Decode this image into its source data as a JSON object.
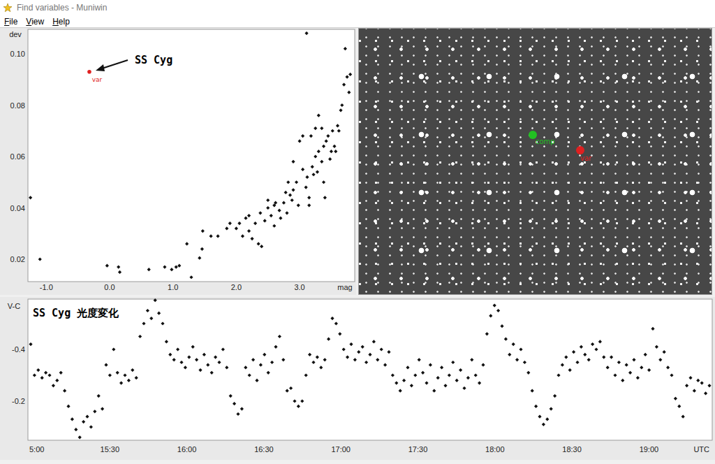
{
  "window": {
    "title": "Find variables - Muniwin"
  },
  "menu": [
    "File",
    "View",
    "Help"
  ],
  "scatter_chart": {
    "y_label": "dev",
    "x_label": "mag",
    "y_ticks": [
      "0.10",
      "0.08",
      "0.06",
      "0.04",
      "0.02"
    ],
    "x_ticks": [
      "-1.0",
      "0.0",
      "1.0",
      "2.0",
      "3.0"
    ],
    "annotation": "SS Cyg",
    "variable": {
      "label": "var",
      "mag": -0.32,
      "dev": 0.093,
      "color": "#e02020"
    },
    "stars": [
      [
        -1.25,
        0.044
      ],
      [
        -1.1,
        0.02
      ],
      [
        -0.04,
        0.0175
      ],
      [
        0.14,
        0.017
      ],
      [
        0.16,
        0.015
      ],
      [
        0.62,
        0.016
      ],
      [
        0.87,
        0.017
      ],
      [
        0.98,
        0.016
      ],
      [
        1.05,
        0.017
      ],
      [
        1.1,
        0.0175
      ],
      [
        1.29,
        0.013
      ],
      [
        1.22,
        0.026
      ],
      [
        1.42,
        0.0205
      ],
      [
        1.46,
        0.024
      ],
      [
        1.47,
        0.031
      ],
      [
        1.71,
        0.029
      ],
      [
        2.0,
        0.032
      ],
      [
        2.05,
        0.034
      ],
      [
        2.1,
        0.029
      ],
      [
        2.15,
        0.036
      ],
      [
        2.2,
        0.031
      ],
      [
        2.25,
        0.028
      ],
      [
        2.3,
        0.034
      ],
      [
        2.35,
        0.026
      ],
      [
        2.4,
        0.025
      ],
      [
        2.38,
        0.038
      ],
      [
        2.45,
        0.035
      ],
      [
        2.5,
        0.04
      ],
      [
        2.55,
        0.037
      ],
      [
        2.6,
        0.033
      ],
      [
        2.62,
        0.042
      ],
      [
        2.68,
        0.039
      ],
      [
        2.7,
        0.036
      ],
      [
        2.75,
        0.042
      ],
      [
        2.8,
        0.038
      ],
      [
        2.85,
        0.045
      ],
      [
        2.9,
        0.047
      ],
      [
        2.88,
        0.043
      ],
      [
        2.95,
        0.05
      ],
      [
        2.98,
        0.041
      ],
      [
        3.05,
        0.055
      ],
      [
        3.1,
        0.048
      ],
      [
        3.12,
        0.052
      ],
      [
        3.15,
        0.041
      ],
      [
        3.2,
        0.056
      ],
      [
        3.22,
        0.053
      ],
      [
        3.25,
        0.06
      ],
      [
        3.28,
        0.054
      ],
      [
        3.3,
        0.062
      ],
      [
        3.35,
        0.058
      ],
      [
        3.38,
        0.064
      ],
      [
        3.4,
        0.044
      ],
      [
        3.42,
        0.066
      ],
      [
        3.45,
        0.068
      ],
      [
        3.5,
        0.062
      ],
      [
        3.55,
        0.064
      ],
      [
        3.6,
        0.072
      ],
      [
        3.62,
        0.07
      ],
      [
        3.65,
        0.078
      ],
      [
        3.7,
        0.088
      ],
      [
        3.75,
        0.091
      ],
      [
        3.78,
        0.085
      ],
      [
        3.8,
        0.092
      ],
      [
        3.72,
        0.102
      ],
      [
        3.11,
        0.108
      ],
      [
        3.0,
        0.066
      ],
      [
        3.05,
        0.068
      ],
      [
        2.9,
        0.058
      ],
      [
        3.3,
        0.076
      ],
      [
        3.25,
        0.071
      ],
      [
        3.18,
        0.068
      ],
      [
        3.35,
        0.071
      ],
      [
        2.6,
        0.041
      ],
      [
        1.6,
        0.029
      ],
      [
        1.85,
        0.032
      ],
      [
        1.9,
        0.034
      ],
      [
        2.2,
        0.037
      ],
      [
        2.5,
        0.043
      ],
      [
        2.78,
        0.046
      ],
      [
        2.82,
        0.05
      ],
      [
        3.15,
        0.044
      ],
      [
        3.38,
        0.05
      ],
      [
        3.48,
        0.059
      ],
      [
        3.57,
        0.062
      ],
      [
        3.52,
        0.07
      ],
      [
        3.67,
        0.08
      ]
    ]
  },
  "star_field": {
    "markers": [
      {
        "label": "comp",
        "color": "#22c022"
      },
      {
        "label": "var",
        "color": "#e02020"
      }
    ]
  },
  "light_curve": {
    "title": "SS Cyg 光度変化",
    "y_label": "V-C",
    "y_ticks": [
      "-0.4",
      "-0.2"
    ],
    "x_ticks": [
      "5:00",
      "15:30",
      "16:00",
      "16:30",
      "17:00",
      "17:30",
      "18:00",
      "18:30",
      "19:00"
    ],
    "x_unit": "UTC",
    "values": [
      -0.42,
      -0.3,
      -0.32,
      -0.29,
      -0.31,
      -0.3,
      -0.26,
      -0.28,
      -0.31,
      -0.24,
      -0.18,
      -0.13,
      -0.09,
      -0.06,
      -0.12,
      -0.14,
      -0.1,
      -0.16,
      -0.22,
      -0.17,
      -0.34,
      -0.3,
      -0.4,
      -0.31,
      -0.27,
      -0.3,
      -0.28,
      -0.32,
      -0.29,
      -0.45,
      -0.5,
      -0.55,
      -0.52,
      -0.59,
      -0.54,
      -0.5,
      -0.43,
      -0.38,
      -0.36,
      -0.4,
      -0.35,
      -0.33,
      -0.37,
      -0.41,
      -0.36,
      -0.32,
      -0.38,
      -0.34,
      -0.31,
      -0.37,
      -0.35,
      -0.4,
      -0.33,
      -0.22,
      -0.19,
      -0.15,
      -0.17,
      -0.33,
      -0.3,
      -0.36,
      -0.28,
      -0.34,
      -0.38,
      -0.31,
      -0.35,
      -0.41,
      -0.45,
      -0.36,
      -0.24,
      -0.25,
      -0.2,
      -0.18,
      -0.2,
      -0.3,
      -0.38,
      -0.35,
      -0.37,
      -0.33,
      -0.36,
      -0.44,
      -0.52,
      -0.5,
      -0.46,
      -0.4,
      -0.37,
      -0.42,
      -0.36,
      -0.39,
      -0.41,
      -0.35,
      -0.38,
      -0.43,
      -0.36,
      -0.4,
      -0.34,
      -0.39,
      -0.3,
      -0.27,
      -0.24,
      -0.28,
      -0.33,
      -0.26,
      -0.3,
      -0.36,
      -0.31,
      -0.27,
      -0.34,
      -0.24,
      -0.29,
      -0.33,
      -0.26,
      -0.3,
      -0.35,
      -0.28,
      -0.32,
      -0.25,
      -0.29,
      -0.36,
      -0.3,
      -0.27,
      -0.34,
      -0.46,
      -0.53,
      -0.57,
      -0.55,
      -0.49,
      -0.44,
      -0.38,
      -0.42,
      -0.36,
      -0.4,
      -0.35,
      -0.31,
      -0.24,
      -0.18,
      -0.14,
      -0.11,
      -0.13,
      -0.17,
      -0.22,
      -0.3,
      -0.34,
      -0.37,
      -0.32,
      -0.39,
      -0.35,
      -0.41,
      -0.38,
      -0.36,
      -0.42,
      -0.4,
      -0.43,
      -0.37,
      -0.33,
      -0.37,
      -0.3,
      -0.35,
      -0.28,
      -0.34,
      -0.31,
      -0.36,
      -0.29,
      -0.33,
      -0.38,
      -0.32,
      -0.48,
      -0.41,
      -0.36,
      -0.39,
      -0.33,
      -0.3,
      -0.21,
      -0.18,
      -0.14,
      -0.26,
      -0.29,
      -0.24,
      -0.28,
      -0.27,
      -0.23,
      -0.26
    ]
  }
}
